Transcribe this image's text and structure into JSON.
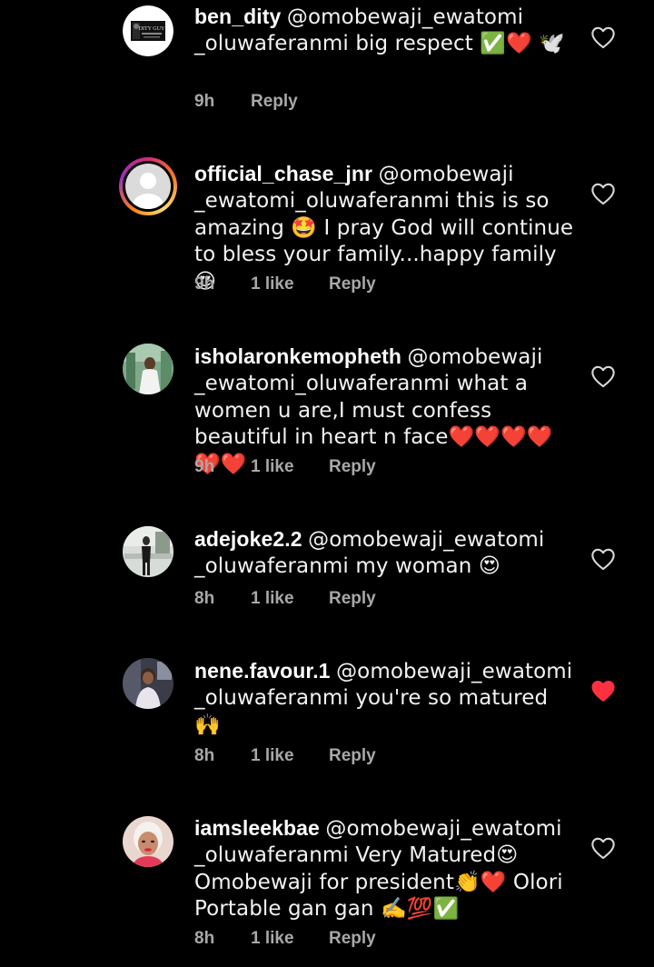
{
  "comments": [
    {
      "username": "ben_dity",
      "text": "@omobewaji_ewatomi _oluwaferanmi big respect ✅❤️ 🕊️",
      "time": "9h",
      "likes": "",
      "reply": "Reply",
      "liked": false,
      "avatar_text": "DITY GUY"
    },
    {
      "username": "official_chase_jnr",
      "text": "@omobewaji _ewatomi_oluwaferanmi this is so amazing 🤩 I pray God will continue to bless your family...happy family 😍",
      "time": "9h",
      "likes": "1 like",
      "reply": "Reply",
      "liked": false
    },
    {
      "username": "isholaronkemopheth",
      "text": "@omobewaji _ewatomi_oluwaferanmi what a women u are,I must confess beautiful in heart n face❤️❤️❤️❤️❤️❤️",
      "time": "9h",
      "likes": "1 like",
      "reply": "Reply",
      "liked": false
    },
    {
      "username": "adejoke2.2",
      "text": "@omobewaji_ewatomi _oluwaferanmi my woman 😍",
      "time": "8h",
      "likes": "1 like",
      "reply": "Reply",
      "liked": false
    },
    {
      "username": "nene.favour.1",
      "text": "@omobewaji_ewatomi _oluwaferanmi you're so matured 🙌",
      "time": "8h",
      "likes": "1 like",
      "reply": "Reply",
      "liked": true
    },
    {
      "username": "iamsleekbae",
      "text": "@omobewaji_ewatomi _oluwaferanmi Very Matured😍 Omobewaji for president👏❤️ Olori Portable gan gan ✍️💯✅",
      "time": "8h",
      "likes": "1 like",
      "reply": "Reply",
      "liked": false
    }
  ],
  "colors": {
    "background": "#000000",
    "text": "#f2f2f2",
    "meta": "#a8a8a8",
    "heart_liked": "#ff3040",
    "heart_outline": "#d8d8d8"
  },
  "icons": {
    "heart": "heart-icon",
    "heart_filled": "heart-filled-icon"
  }
}
